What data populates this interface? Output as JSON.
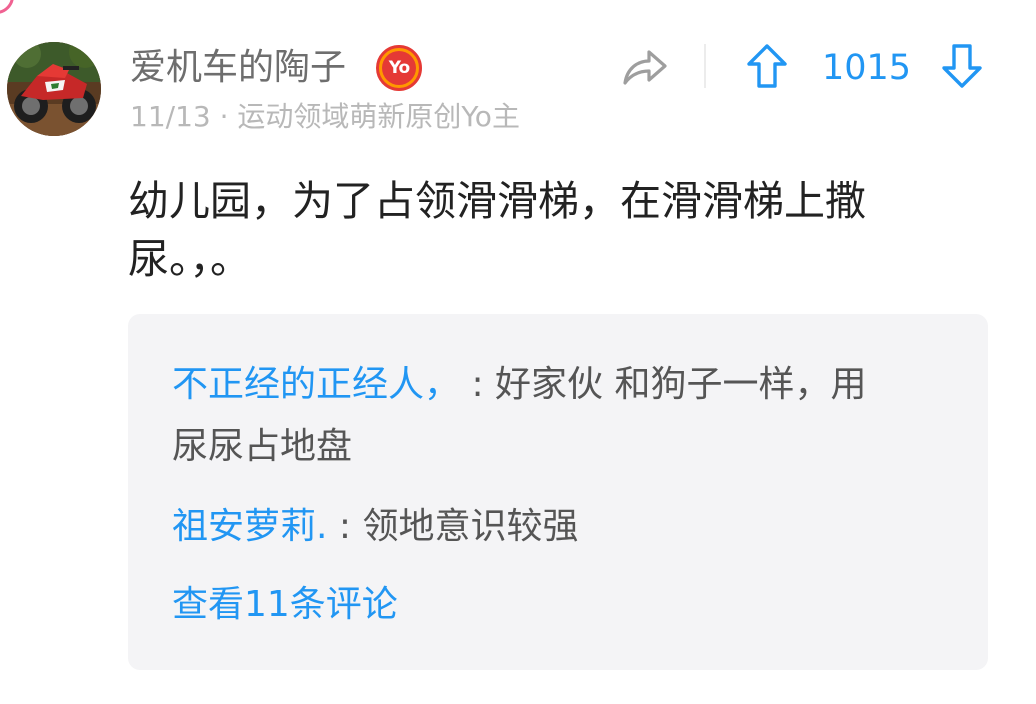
{
  "post": {
    "author": "爱机车的陶子",
    "badge_text": "Yo",
    "date": "11/13",
    "separator": "·",
    "user_title": "运动领域萌新原创Yo主",
    "vote_count": "1015",
    "content": "幼儿园，为了占领滑滑梯，在滑滑梯上撒尿。，。"
  },
  "icons": {
    "share": "share-arrow-icon",
    "upvote": "arrow-up-icon",
    "downvote": "arrow-down-icon",
    "badge": "yo-badge-icon"
  },
  "comments": [
    {
      "author": "不正经的正经人，",
      "text": "好家伙 和狗子一样，用尿尿占地盘"
    },
    {
      "author": "祖安萝莉.",
      "text": "领地意识较强"
    }
  ],
  "comment_separator": " : ",
  "view_all_label": "查看11条评论",
  "colors": {
    "accent": "#2196f3",
    "comment_bg": "#f4f4f6",
    "meta_text": "#b8b8b8",
    "badge_orange": "#ff9800",
    "badge_red": "#e53935"
  }
}
